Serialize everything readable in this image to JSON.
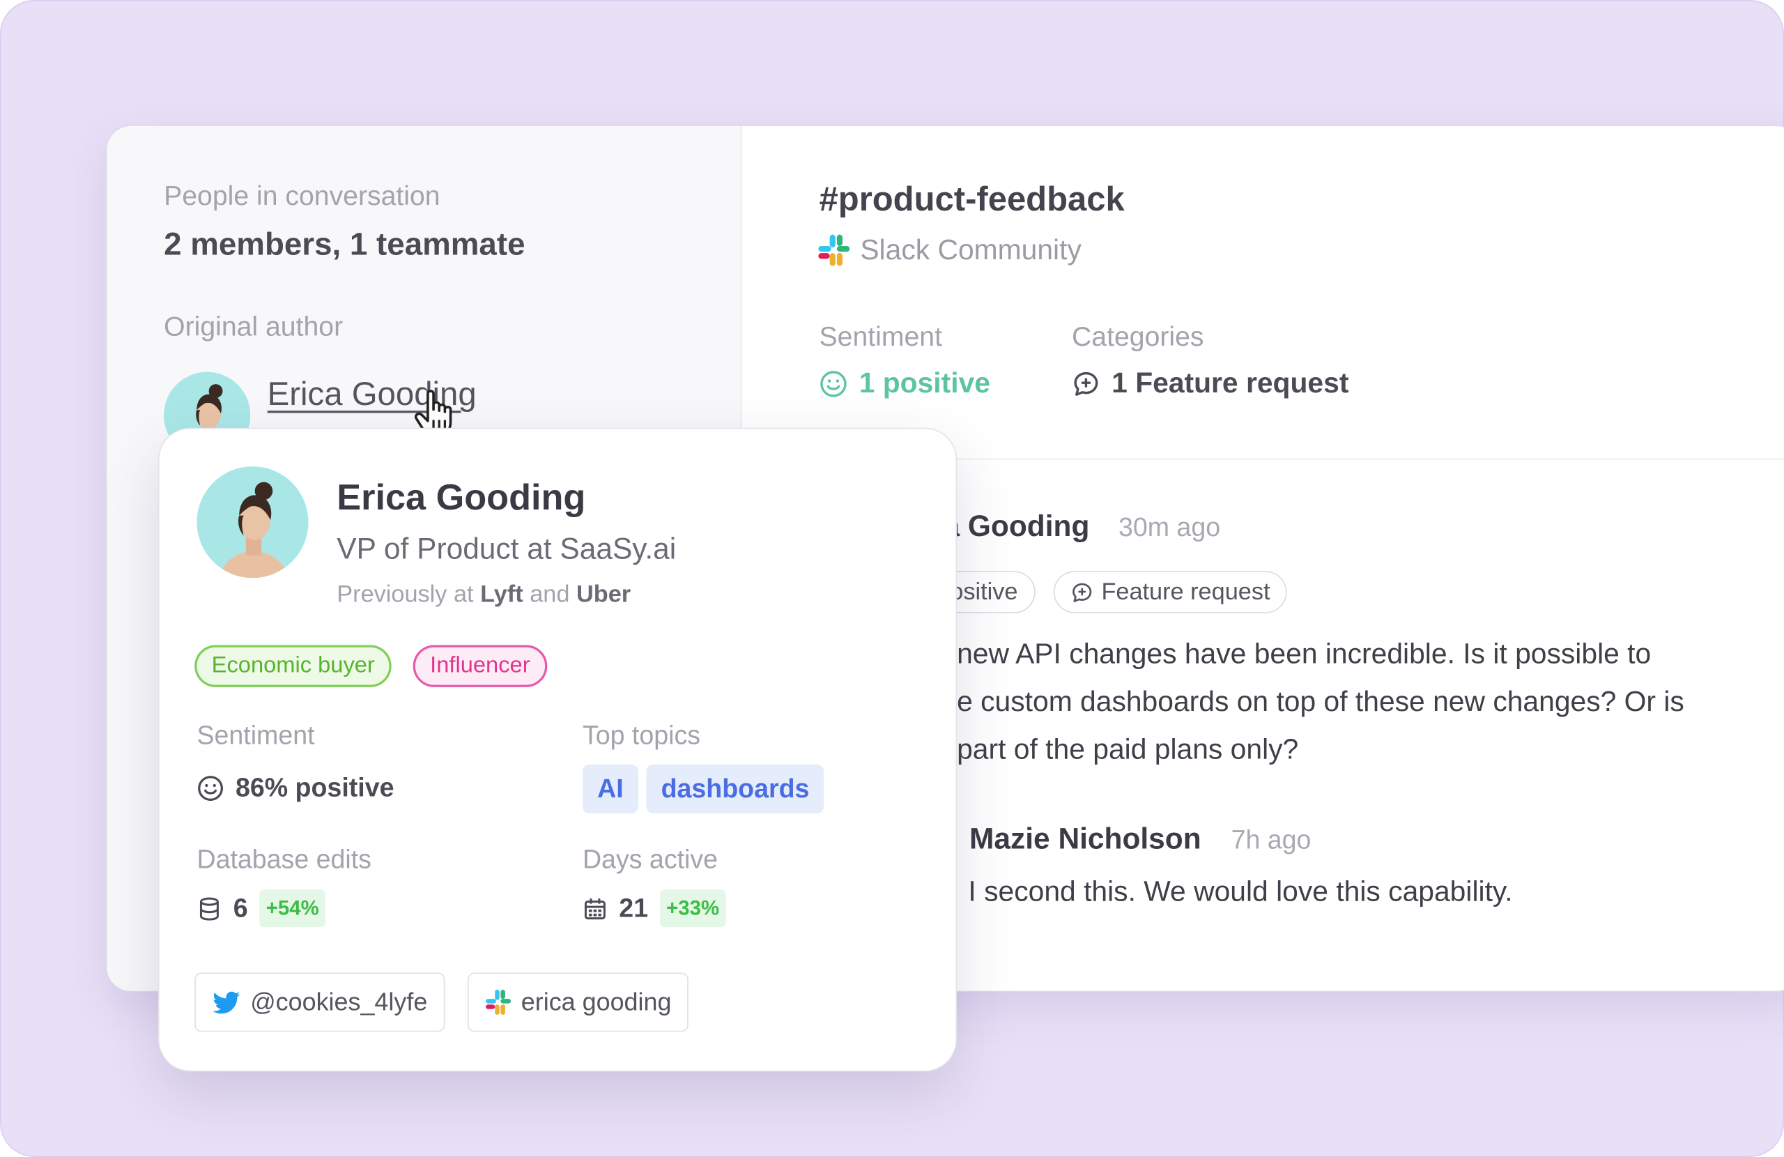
{
  "colors": {
    "background": "#e9e0f7",
    "positive": "#5cc4a3",
    "topic_blue": "#4a6de3",
    "delta_green": "#3bbd47",
    "economic_buyer": "#66c13c",
    "influencer": "#e3379b"
  },
  "sidebar": {
    "people_label": "People in conversation",
    "people_value": "2 members, 1 teammate",
    "author_label": "Original author",
    "author_name": "Erica Gooding"
  },
  "channel": {
    "title": "#product-feedback",
    "source": "Slack Community",
    "source_icon": "slack-icon",
    "sentiment_label": "Sentiment",
    "sentiment_value": "1 positive",
    "categories_label": "Categories",
    "categories_value": "1 Feature request"
  },
  "messages": [
    {
      "author": "a Gooding",
      "time": "30m ago",
      "chips": [
        "ositive",
        "Feature request"
      ],
      "lines": [
        "new API changes have been incredible. Is it possible to",
        "e custom dashboards on top of these new changes? Or is",
        "part of the paid plans only?"
      ]
    },
    {
      "author": "Mazie Nicholson",
      "time": "7h ago",
      "lines": [
        "I second this. We would love this capability."
      ]
    }
  ],
  "profile_card": {
    "name": "Erica Gooding",
    "role": "VP of Product at SaaSy.ai",
    "previously_prefix": "Previously at",
    "previously_company_1": "Lyft",
    "previously_and": "and",
    "previously_company_2": "Uber",
    "tags": [
      "Economic buyer",
      "Influencer"
    ],
    "sentiment_label": "Sentiment",
    "sentiment_value": "86% positive",
    "topics_label": "Top topics",
    "topics": [
      "AI",
      "dashboards"
    ],
    "db_edits_label": "Database edits",
    "db_edits_value": "6",
    "db_edits_delta": "+54%",
    "days_active_label": "Days active",
    "days_active_value": "21",
    "days_active_delta": "+33%",
    "twitter_handle": "@cookies_4lyfe",
    "slack_handle": "erica gooding"
  }
}
